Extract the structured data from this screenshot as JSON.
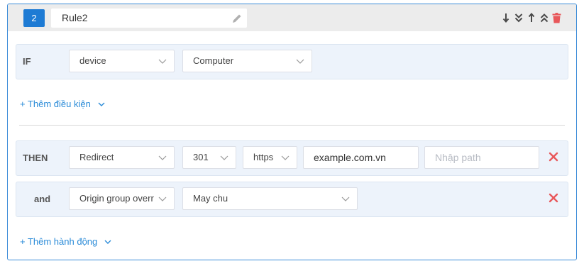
{
  "rule": {
    "index": "2",
    "name": "Rule2"
  },
  "header_icons": [
    "arrow-down-icon",
    "double-chevron-down-icon",
    "arrow-up-icon",
    "double-chevron-up-icon",
    "trash-icon"
  ],
  "colors": {
    "accent": "#1e7bd4",
    "link": "#2a8bd8",
    "delete": "#e8575a",
    "row_bg": "#edf3fb"
  },
  "condition": {
    "label": "IF",
    "field": "device",
    "value": "Computer"
  },
  "add_condition_label": "+ Thêm điều kiện",
  "action": {
    "label": "THEN",
    "type": "Redirect",
    "code": "301",
    "scheme": "https",
    "host": "example.com.vn",
    "path_placeholder": "Nhập path"
  },
  "extra_action": {
    "label": "and",
    "type": "Origin group overr",
    "value": "May chu"
  },
  "add_action_label": "+ Thêm hành động"
}
